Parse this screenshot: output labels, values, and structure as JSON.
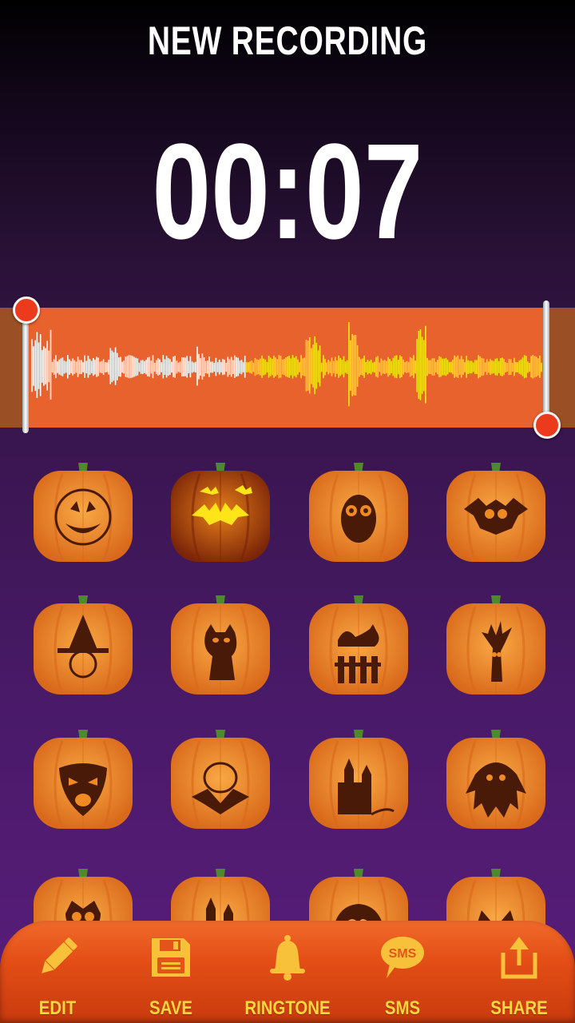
{
  "header": {
    "title": "NEW RECORDING"
  },
  "timer": {
    "value": "00:07"
  },
  "waveform": {
    "trim_start_fraction": 0.0,
    "trim_end_fraction": 1.0,
    "played_fraction": 0.42,
    "played_color": "#ffffff",
    "unplayed_color": "#ffe619",
    "background_color": "#e8622e"
  },
  "effects": [
    {
      "name": "jack-o-lantern",
      "icon": "jack-o-lantern-icon",
      "selected": false
    },
    {
      "name": "bats",
      "icon": "bats-icon",
      "selected": true
    },
    {
      "name": "owl",
      "icon": "owl-icon",
      "selected": false
    },
    {
      "name": "bat-face",
      "icon": "bat-face-icon",
      "selected": false
    },
    {
      "name": "witch",
      "icon": "witch-icon",
      "selected": false
    },
    {
      "name": "cat",
      "icon": "cat-icon",
      "selected": false
    },
    {
      "name": "black-cat-fence",
      "icon": "black-cat-fence-icon",
      "selected": false
    },
    {
      "name": "haunted-tree",
      "icon": "haunted-tree-icon",
      "selected": false
    },
    {
      "name": "mask",
      "icon": "mask-icon",
      "selected": false
    },
    {
      "name": "vampire-kid",
      "icon": "vampire-kid-icon",
      "selected": false
    },
    {
      "name": "haunted-castle",
      "icon": "haunted-castle-icon",
      "selected": false
    },
    {
      "name": "ghost",
      "icon": "ghost-icon",
      "selected": false
    },
    {
      "name": "owl-2",
      "icon": "owl-icon",
      "selected": false
    },
    {
      "name": "castle-2",
      "icon": "haunted-castle-icon",
      "selected": false
    },
    {
      "name": "monster-hair",
      "icon": "monster-icon",
      "selected": false
    },
    {
      "name": "cat-2",
      "icon": "cat-icon",
      "selected": false
    }
  ],
  "toolbar": {
    "edit": "EDIT",
    "save": "SAVE",
    "ringtone": "RINGTONE",
    "sms": "SMS",
    "sms_icon_text": "SMS",
    "share": "SHARE"
  }
}
